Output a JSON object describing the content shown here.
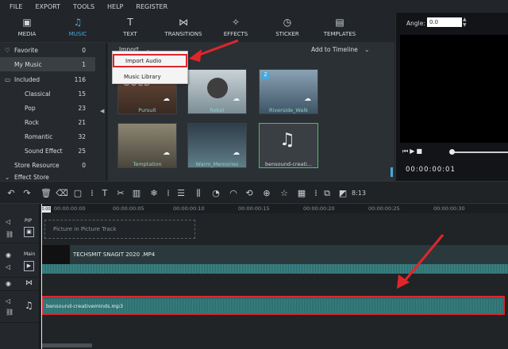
{
  "menu": [
    "FILE",
    "EXPORT",
    "TOOLS",
    "HELP",
    "REGISTER"
  ],
  "tabs": [
    {
      "label": "MEDIA",
      "icon": "media-icon"
    },
    {
      "label": "MUSIC",
      "icon": "music-icon"
    },
    {
      "label": "TEXT",
      "icon": "text-icon"
    },
    {
      "label": "TRANSITIONS",
      "icon": "transitions-icon"
    },
    {
      "label": "EFFECTS",
      "icon": "effects-icon"
    },
    {
      "label": "STICKER",
      "icon": "sticker-icon"
    },
    {
      "label": "TEMPLATES",
      "icon": "templates-icon"
    }
  ],
  "sidebar": [
    {
      "label": "Favorite",
      "count": "0"
    },
    {
      "label": "My Music",
      "count": "1"
    },
    {
      "label": "Included",
      "count": "116"
    },
    {
      "label": "Classical",
      "count": "15"
    },
    {
      "label": "Pop",
      "count": "23"
    },
    {
      "label": "Rock",
      "count": "21"
    },
    {
      "label": "Romantic",
      "count": "32"
    },
    {
      "label": "Sound Effect",
      "count": "25"
    },
    {
      "label": "Store Resource",
      "count": "0"
    },
    {
      "label": "Effect Store",
      "count": ""
    }
  ],
  "content": {
    "import_label": "Import",
    "add_to_timeline": "Add to Timeline",
    "menu_items": [
      "Import Audio",
      "Music Library"
    ],
    "thumbs": [
      {
        "caption": "Pursuit"
      },
      {
        "caption": "Rebel"
      },
      {
        "caption": "Riverside_Walk"
      },
      {
        "caption": "Temptation"
      },
      {
        "caption": "Warm_Memories"
      },
      {
        "caption": "bensound-creati..."
      }
    ]
  },
  "preview": {
    "angle_label": "Angle:",
    "angle_value": "0.0",
    "time": "00:00:00:01"
  },
  "ruler": [
    "00:00:00:00",
    "00:00:00:05",
    "00:00:00:10",
    "00:00:00:15",
    "00:00:00:20",
    "00:00:00:25",
    "00:00:00:30"
  ],
  "ruler_marker": "0:00",
  "zoom_label": "8:13",
  "tracks": {
    "pip_label": "PIP",
    "pip_placeholder": "Picture in Picture Track",
    "main_label": "Main",
    "main_clip": "TECHSMIT SNAGIT 2020 .MP4",
    "audio_clip": "bensound-creativeminds.mp3"
  },
  "colors": {
    "accent": "#4aa8d8",
    "highlight": "#e0262b",
    "wave": "#3f8a8b"
  }
}
